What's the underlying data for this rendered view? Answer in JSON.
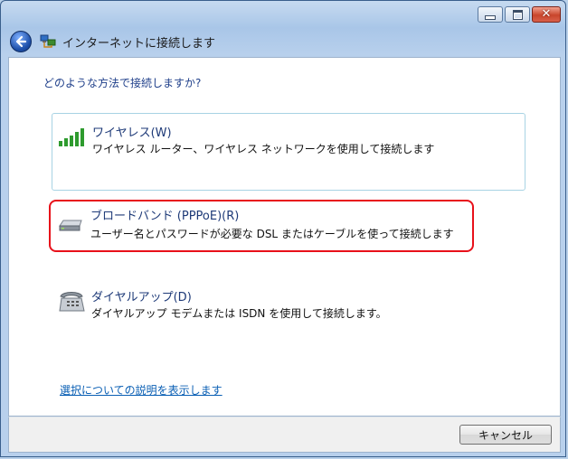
{
  "window": {
    "buttons": {
      "minimize": "minimize",
      "maximize": "maximize",
      "close": "✕"
    }
  },
  "nav": {
    "title": "インターネットに接続します"
  },
  "content": {
    "question": "どのような方法で接続しますか?",
    "options": [
      {
        "title": "ワイヤレス(W)",
        "description": "ワイヤレス ルーター、ワイヤレス ネットワークを使用して接続します",
        "icon": "wireless-signal-icon"
      },
      {
        "title": "ブロードバンド (PPPoE)(R)",
        "description": "ユーザー名とパスワードが必要な DSL またはケーブルを使って接続します",
        "icon": "modem-icon"
      },
      {
        "title": "ダイヤルアップ(D)",
        "description": "ダイヤルアップ モデムまたは ISDN を使用して接続します。",
        "icon": "telephone-icon"
      }
    ],
    "help_link": "選択についての説明を表示します"
  },
  "footer": {
    "cancel_label": "キャンセル"
  },
  "colors": {
    "highlight": "#e8101a",
    "link": "#0a5fb4",
    "title_text": "#1e3a78"
  }
}
